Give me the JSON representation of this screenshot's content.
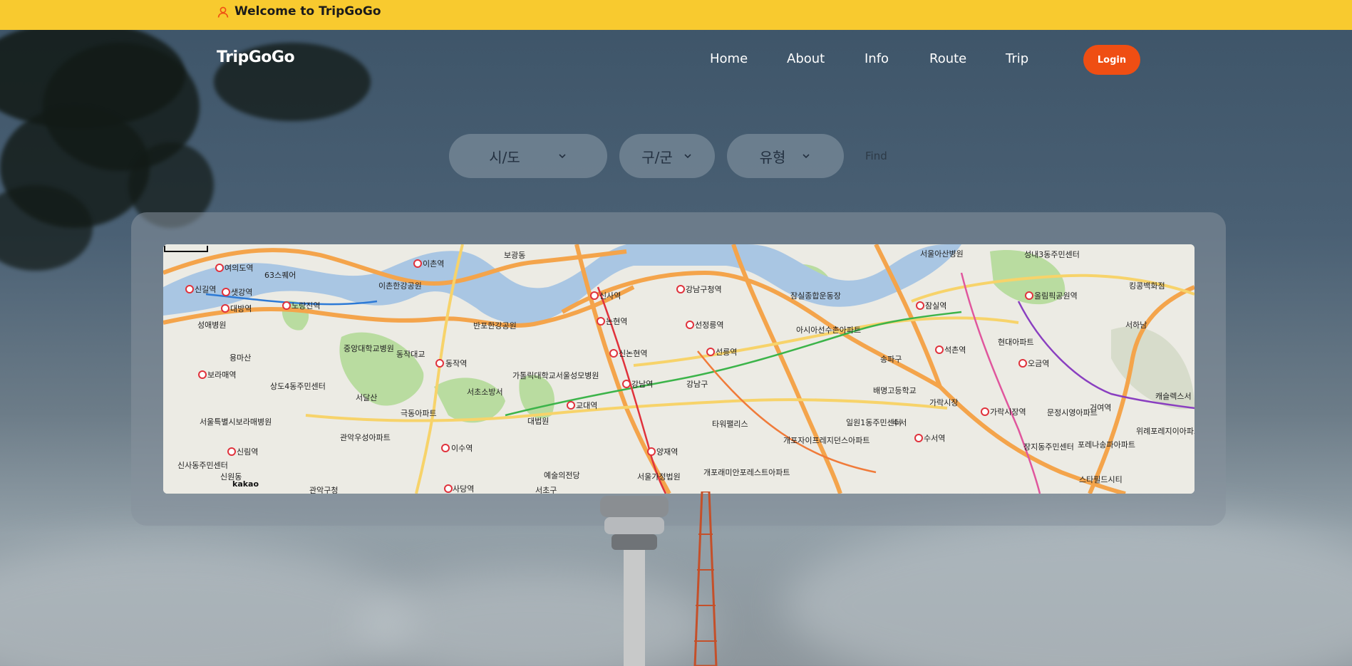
{
  "banner": {
    "welcome_text": "Welcome to TripGoGo",
    "icon": "person-icon",
    "background": "#f8ca2f"
  },
  "header": {
    "logo": "TripGoGo",
    "nav": [
      {
        "label": "Home"
      },
      {
        "label": "About"
      },
      {
        "label": "Info"
      },
      {
        "label": "Route"
      },
      {
        "label": "Trip"
      }
    ],
    "login_label": "Login",
    "login_color": "#ef4e13"
  },
  "search": {
    "sido_label": "시/도",
    "gugun_label": "구/군",
    "type_label": "유형",
    "find_label": "Find"
  },
  "map": {
    "attribution": "kakao",
    "place_labels": [
      "이촌역",
      "보광동",
      "반포한강공원",
      "신사역",
      "논현역",
      "신논현역",
      "강남역",
      "교대역",
      "양재역",
      "서울가정법원",
      "대법원",
      "서초소방서",
      "강남구청역",
      "선정릉역",
      "선릉역",
      "강남구",
      "타워팰리스",
      "잠실종합운동장",
      "아시아선수촌아파트",
      "송파구",
      "배명고등학교",
      "잠실역",
      "석촌역",
      "가락시장",
      "서울아산병원",
      "성내3동주민센터",
      "올림픽공원역",
      "현대아파트",
      "오금역",
      "거여역",
      "서하남",
      "킹콩백화점",
      "캐슬렉스서",
      "위례포레지이아파트",
      "포레나송파아파트",
      "장지동주민센터",
      "스타필드시티",
      "문정시영아파트",
      "가락시장역",
      "수서역",
      "수서",
      "일원1동주민센터",
      "개포자이프레지던스아파트",
      "개포래미안포레스트아파트",
      "이수역",
      "동작역",
      "동작대교",
      "극동아파트",
      "사당역",
      "신림역",
      "관악구청",
      "신사동주민센터",
      "신원동",
      "관악우성아파트",
      "서울특별시보라매병원",
      "보라매역",
      "상도4동주민센터",
      "중앙대학교병원",
      "용마산",
      "노량진역",
      "대방역",
      "샛강역",
      "여의도역",
      "신길역",
      "성애병원",
      "가톨릭대학교서울성모병원",
      "예술의전당",
      "서초구",
      "63스퀘어",
      "이촌한강공원",
      "서달산"
    ]
  }
}
